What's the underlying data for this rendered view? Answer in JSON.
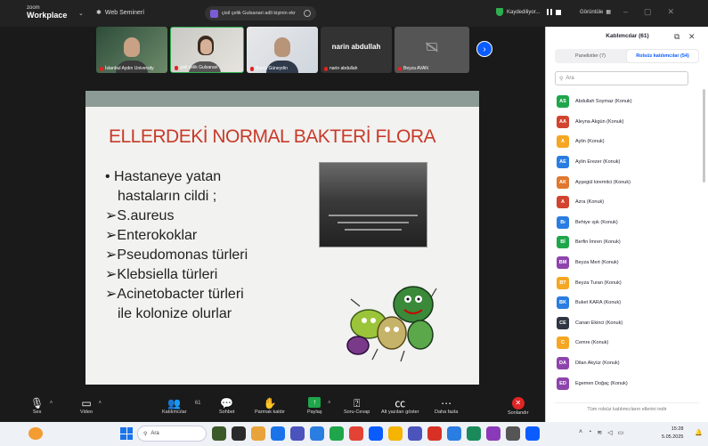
{
  "titlebar": {
    "logo_small": "zoom",
    "logo_big": "Workplace",
    "webinar_label": "Web Seminerí",
    "share_label": "çisil çelik Gulsanari adli kişinin ekr",
    "saved_label": "Kaydediliyor...",
    "view_label": "Görüntüle"
  },
  "videos": [
    {
      "name": "İstanbul Aydın University",
      "type": "camera"
    },
    {
      "name": "çisil çelik Gulsanari",
      "type": "camera"
    },
    {
      "name": "Burcu Güneydin",
      "type": "camera"
    },
    {
      "name": "narin abdullah",
      "type": "text",
      "display": "narin abdullah"
    },
    {
      "name": "Beyza AVAN",
      "type": "off"
    }
  ],
  "slide": {
    "title": "ELLERDEKİ NORMAL BAKTERİ FLORA",
    "lines": [
      "• Hastaneye yatan",
      "hastaların cildi ;",
      "➢S.aureus",
      "➢Enterokoklar",
      "➢Pseudomonas türleri",
      "➢Klebsiella türleri",
      "➢Acinetobacter türleri",
      "ile kolonize olurlar"
    ]
  },
  "toolbar": {
    "audio": "Ses",
    "video": "Video",
    "participants": "Katılımcılar",
    "participants_count": "61",
    "chat": "Sohbet",
    "raise_hand": "Parmak kaldır",
    "share": "Paylaş",
    "qa": "Soru-Cevap",
    "captions": "Alt yazıları göster",
    "more": "Daha fazla",
    "end": "Sonlandır"
  },
  "panel": {
    "title": "Katılımcılar (61)",
    "tab_panelists": "Panelistler (7)",
    "tab_attendees": "Rolsüz katılımcılar (54)",
    "search_placeholder": "Ara",
    "footer": "Tüm rolsüz katılımcıların ellerini indir",
    "attendees": [
      {
        "initials": "AS",
        "name": "Abdullah Soymaz (Konuk)",
        "color": "#1fa64a"
      },
      {
        "initials": "AA",
        "name": "Aleyna Akgün (Konuk)",
        "color": "#d1442f"
      },
      {
        "initials": "A",
        "name": "Aylin (Konuk)",
        "color": "#f5a623"
      },
      {
        "initials": "AE",
        "name": "Aylin Erezer (Konuk)",
        "color": "#2a7de1"
      },
      {
        "initials": "AK",
        "name": "Ayşegül kiremitci (Konuk)",
        "color": "#e0782f"
      },
      {
        "initials": "A",
        "name": "Azra (Konuk)",
        "color": "#d1442f"
      },
      {
        "initials": "Bı",
        "name": "Behiye ışık (Konuk)",
        "color": "#2a7de1"
      },
      {
        "initials": "Bİ",
        "name": "Berfin İmren (Konuk)",
        "color": "#1fa64a"
      },
      {
        "initials": "BM",
        "name": "Beyza Mert (Konuk)",
        "color": "#8e44ad"
      },
      {
        "initials": "BT",
        "name": "Beyza Turan (Konuk)",
        "color": "#f5a623"
      },
      {
        "initials": "BK",
        "name": "Buket KARA (Konuk)",
        "color": "#2a7de1"
      },
      {
        "initials": "CE",
        "name": "Canan Ekinci (Konuk)",
        "color": "#2f3542"
      },
      {
        "initials": "C",
        "name": "Cemre (Konuk)",
        "color": "#f5a623"
      },
      {
        "initials": "DA",
        "name": "Dilan Akyüz (Konuk)",
        "color": "#8e44ad"
      },
      {
        "initials": "ED",
        "name": "Egemen Doğaç (Konuk)",
        "color": "#8e44ad"
      }
    ]
  },
  "taskbar": {
    "search_placeholder": "Ara",
    "time": "15:28",
    "date": "5.05.2025"
  }
}
